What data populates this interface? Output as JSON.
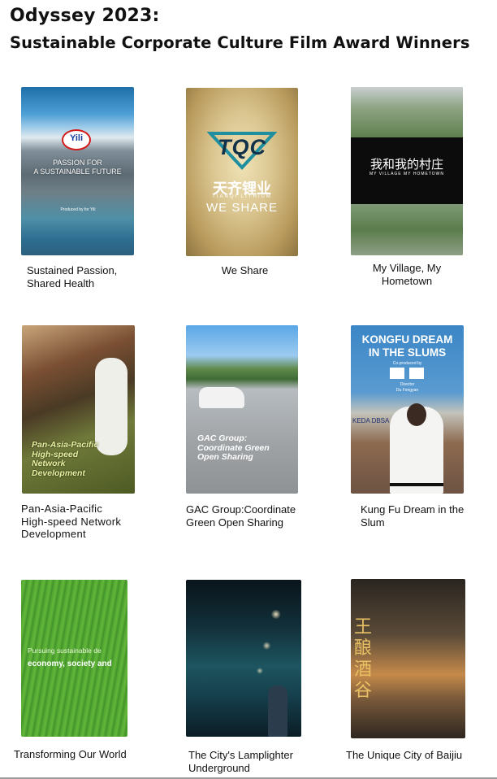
{
  "header": {
    "title_line1": "Odyssey 2023:",
    "title_line2": "Sustainable Corporate Culture Film Award Winners"
  },
  "films": [
    {
      "caption": "Sustained Passion,\nShared Health",
      "poster": {
        "brand": "Yili",
        "headline": "PASSION FOR\nA SUSTAINABLE FUTURE",
        "credit": "Produced by           for Yili"
      }
    },
    {
      "caption": "We Share",
      "poster": {
        "logo": "TQC",
        "company_cn": "天齐锂业",
        "company_en": "TIANQI LITHIUM",
        "tagline": "WE  SHARE"
      }
    },
    {
      "caption": "My Village, My\nHometown",
      "poster": {
        "title_cn": "我和我的村庄",
        "title_en": "MY VILLAGE  MY HOMETOWN"
      }
    },
    {
      "caption": "Pan-Asia-Pacific\nHigh-speed Network\nDevelopment",
      "poster": {
        "headline": "Pan-Asia-Pacific\nHigh-speed\nNetwork\nDevelopment"
      }
    },
    {
      "caption": "GAC Group:Coordinate\nGreen Open Sharing",
      "poster": {
        "headline": "GAC Group:\nCoordinate Green\nOpen Sharing"
      }
    },
    {
      "caption": "Kung Fu Dream in the\nSlum",
      "poster": {
        "title": "KONGFU DREAM\nIN THE SLUMS",
        "subtitle": "Co-produced by",
        "director_label": "Director",
        "director": "Du Fengyan",
        "sign": "KEDA DBSA"
      }
    },
    {
      "caption": "Transforming Our World",
      "poster": {
        "line1": "Pursuing sustainable de",
        "line2": "economy, society and"
      }
    },
    {
      "caption": "The City's Lamplighter\nUnderground",
      "poster": {}
    },
    {
      "caption": "The Unique City of Baijiu",
      "poster": {
        "title_cn": "王酿酒谷"
      }
    }
  ],
  "colors": {
    "text": "#111111",
    "background": "#ffffff"
  }
}
